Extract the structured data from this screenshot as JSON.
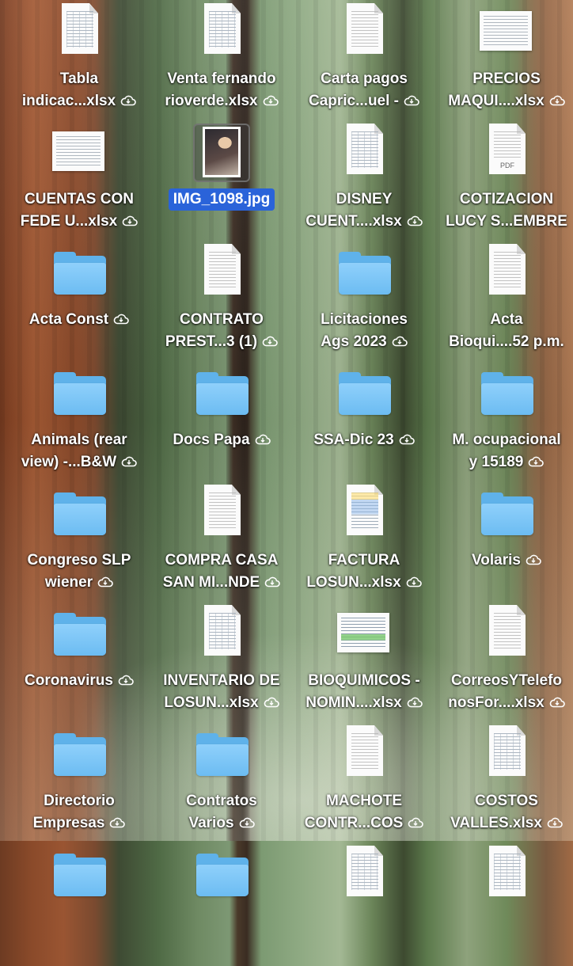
{
  "desktop": {
    "wallpaper": "forest",
    "selection_color": "#2a63d9",
    "items": [
      {
        "line1": "Tabla",
        "line2": "indicac...xlsx",
        "icon": "spreadsheet-icon",
        "cloud": true
      },
      {
        "line1": "Venta fernando",
        "line2": "rioverde.xlsx",
        "icon": "spreadsheet-icon",
        "cloud": true
      },
      {
        "line1": "Carta pagos",
        "line2": "Capric...uel -",
        "icon": "document-icon",
        "cloud": true
      },
      {
        "line1": "PRECIOS",
        "line2": "MAQUI....xlsx",
        "icon": "spreadsheet-icon",
        "cloud": true
      },
      {
        "line1": "CUENTAS CON",
        "line2": "FEDE U...xlsx",
        "icon": "spreadsheet-icon",
        "cloud": true
      },
      {
        "line1": "IMG_1098.jpg",
        "line2": "",
        "icon": "photo-icon",
        "cloud": false,
        "selected": true
      },
      {
        "line1": "DISNEY",
        "line2": "CUENT....xlsx",
        "icon": "spreadsheet-icon",
        "cloud": true
      },
      {
        "line1": "COTIZACION",
        "line2": "LUCY S...EMBRE",
        "icon": "pdf-icon",
        "cloud": false,
        "badge": "PDF"
      },
      {
        "line1": "Acta Const",
        "line2": "",
        "icon": "folder-icon",
        "cloud": true
      },
      {
        "line1": "CONTRATO",
        "line2": "PREST...3 (1)",
        "icon": "document-icon",
        "cloud": true
      },
      {
        "line1": "Licitaciones",
        "line2": "Ags 2023",
        "icon": "folder-icon",
        "cloud": true
      },
      {
        "line1": "Acta",
        "line2": "Bioqui....52 p.m.",
        "icon": "document-icon",
        "cloud": false
      },
      {
        "line1": "Animals (rear",
        "line2": "view) -...B&W",
        "icon": "folder-icon",
        "cloud": true
      },
      {
        "line1": "Docs Papa",
        "line2": "",
        "icon": "folder-icon",
        "cloud": true
      },
      {
        "line1": "SSA-Dic 23",
        "line2": "",
        "icon": "folder-icon",
        "cloud": true
      },
      {
        "line1": "M. ocupacional",
        "line2": "y 15189",
        "icon": "folder-icon",
        "cloud": true
      },
      {
        "line1": "Congreso SLP",
        "line2": "wiener",
        "icon": "folder-icon",
        "cloud": true
      },
      {
        "line1": "COMPRA CASA",
        "line2": "SAN MI...NDE",
        "icon": "document-icon",
        "cloud": true
      },
      {
        "line1": "FACTURA",
        "line2": "LOSUN...xlsx",
        "icon": "spreadsheet-icon",
        "cloud": true
      },
      {
        "line1": "Volaris",
        "line2": "",
        "icon": "folder-icon",
        "cloud": true
      },
      {
        "line1": "Coronavirus",
        "line2": "",
        "icon": "folder-icon",
        "cloud": true
      },
      {
        "line1": "INVENTARIO DE",
        "line2": "LOSUN...xlsx",
        "icon": "spreadsheet-icon",
        "cloud": true
      },
      {
        "line1": "BIOQUIMICOS -",
        "line2": "NOMIN....xlsx",
        "icon": "spreadsheet-icon",
        "cloud": true
      },
      {
        "line1": "CorreosYTelefo",
        "line2": "nosFor....xlsx",
        "icon": "document-icon",
        "cloud": true
      },
      {
        "line1": "Directorio",
        "line2": "Empresas",
        "icon": "folder-icon",
        "cloud": true
      },
      {
        "line1": "Contratos",
        "line2": "Varios",
        "icon": "folder-icon",
        "cloud": true
      },
      {
        "line1": "MACHOTE",
        "line2": "CONTR...COS",
        "icon": "document-icon",
        "cloud": true
      },
      {
        "line1": "COSTOS",
        "line2": "VALLES.xlsx",
        "icon": "spreadsheet-icon",
        "cloud": true
      },
      {
        "line1": "",
        "line2": "",
        "icon": "folder-icon",
        "cloud": false
      },
      {
        "line1": "",
        "line2": "",
        "icon": "folder-icon",
        "cloud": false
      },
      {
        "line1": "",
        "line2": "",
        "icon": "spreadsheet-icon",
        "cloud": false
      },
      {
        "line1": "",
        "line2": "",
        "icon": "spreadsheet-icon",
        "cloud": false
      }
    ]
  }
}
